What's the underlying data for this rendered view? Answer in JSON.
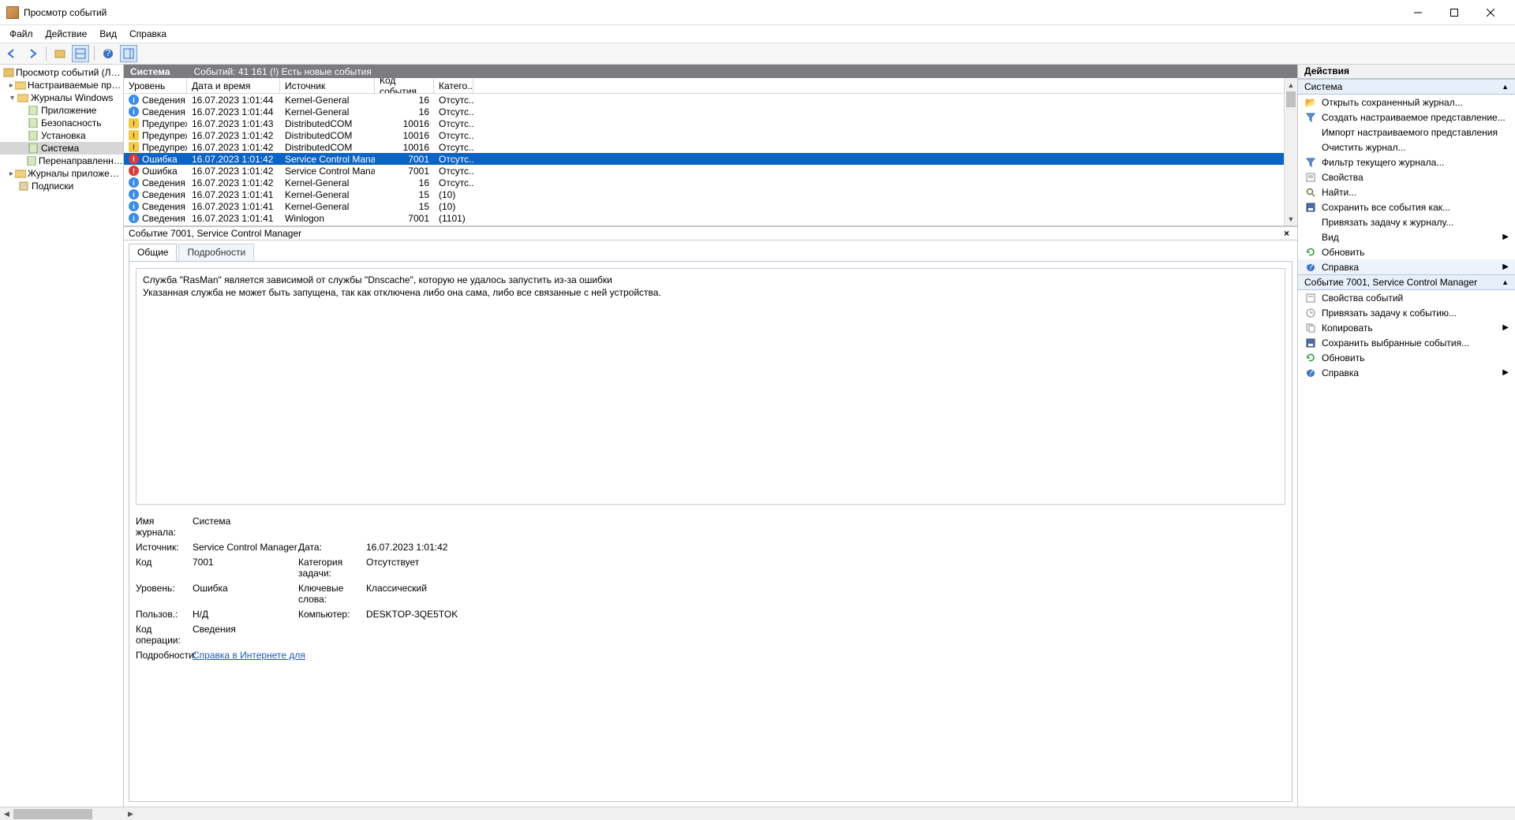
{
  "window": {
    "title": "Просмотр событий"
  },
  "menu": {
    "file": "Файл",
    "action": "Действие",
    "view": "Вид",
    "help": "Справка"
  },
  "tree": {
    "root": "Просмотр событий (Локальн",
    "custom_views": "Настраиваемые представл",
    "windows_logs": "Журналы Windows",
    "app": "Приложение",
    "security": "Безопасность",
    "setup": "Установка",
    "system": "Система",
    "forwarded": "Перенаправленные соб",
    "apps_services": "Журналы приложений и сл",
    "subscriptions": "Подписки"
  },
  "center_header": {
    "name": "Система",
    "info": "Событий: 41 161 (!) Есть новые события"
  },
  "columns": {
    "level": "Уровень",
    "datetime": "Дата и время",
    "source": "Источник",
    "event_id": "Код события",
    "category": "Катего..."
  },
  "levels": {
    "info": "Сведения",
    "warn": "Предупреж...",
    "error": "Ошибка"
  },
  "rows": [
    {
      "lvl": "info",
      "dt": "16.07.2023 1:01:44",
      "src": "Kernel-General",
      "id": "16",
      "cat": "Отсутс..."
    },
    {
      "lvl": "info",
      "dt": "16.07.2023 1:01:44",
      "src": "Kernel-General",
      "id": "16",
      "cat": "Отсутс..."
    },
    {
      "lvl": "warn",
      "dt": "16.07.2023 1:01:43",
      "src": "DistributedCOM",
      "id": "10016",
      "cat": "Отсутс..."
    },
    {
      "lvl": "warn",
      "dt": "16.07.2023 1:01:42",
      "src": "DistributedCOM",
      "id": "10016",
      "cat": "Отсутс..."
    },
    {
      "lvl": "warn",
      "dt": "16.07.2023 1:01:42",
      "src": "DistributedCOM",
      "id": "10016",
      "cat": "Отсутс..."
    },
    {
      "lvl": "error",
      "dt": "16.07.2023 1:01:42",
      "src": "Service Control Manager",
      "id": "7001",
      "cat": "Отсутс...",
      "selected": true
    },
    {
      "lvl": "error",
      "dt": "16.07.2023 1:01:42",
      "src": "Service Control Manager",
      "id": "7001",
      "cat": "Отсутс..."
    },
    {
      "lvl": "info",
      "dt": "16.07.2023 1:01:42",
      "src": "Kernel-General",
      "id": "16",
      "cat": "Отсутс..."
    },
    {
      "lvl": "info",
      "dt": "16.07.2023 1:01:41",
      "src": "Kernel-General",
      "id": "15",
      "cat": "(10)"
    },
    {
      "lvl": "info",
      "dt": "16.07.2023 1:01:41",
      "src": "Kernel-General",
      "id": "15",
      "cat": "(10)"
    },
    {
      "lvl": "info",
      "dt": "16.07.2023 1:01:41",
      "src": "Winlogon",
      "id": "7001",
      "cat": "(1101)"
    }
  ],
  "detail": {
    "caption": "Событие 7001, Service Control Manager",
    "tab_general": "Общие",
    "tab_details": "Подробности",
    "message_l1": "Служба \"RasMan\" является зависимой от службы \"Dnscache\", которую не удалось запустить из-за ошибки",
    "message_l2": "Указанная служба не может быть запущена, так как отключена либо она сама, либо все связанные с ней устройства.",
    "labels": {
      "log_name": "Имя журнала:",
      "source": "Источник:",
      "code": "Код",
      "level": "Уровень:",
      "user": "Пользов.:",
      "opcode": "Код операции:",
      "more_info": "Подробности:",
      "date": "Дата:",
      "task_category": "Категория задачи:",
      "keywords": "Ключевые слова:",
      "computer": "Компьютер:"
    },
    "values": {
      "log_name": "Система",
      "source": "Service Control Manager",
      "code": "7001",
      "level": "Ошибка",
      "user": "Н/Д",
      "opcode": "Сведения",
      "more_info": "Справка в Интернете для ",
      "date": "16.07.2023 1:01:42",
      "task_category": "Отсутствует",
      "keywords": "Классический",
      "computer": "DESKTOP-3QE5TOK"
    }
  },
  "actions": {
    "pane_title": "Действия",
    "group1": "Система",
    "group2": "Событие 7001, Service Control Manager",
    "items1": {
      "open_saved": "Открыть сохраненный журнал...",
      "create_view": "Создать настраиваемое представление...",
      "import_view": "Импорт настраиваемого представления",
      "clear_log": "Очистить журнал...",
      "filter": "Фильтр текущего журнала...",
      "properties": "Свойства",
      "find": "Найти...",
      "save_all": "Сохранить все события как...",
      "attach_to_log": "Привязать задачу к журналу...",
      "view": "Вид",
      "refresh": "Обновить",
      "help": "Справка"
    },
    "items2": {
      "event_props": "Свойства событий",
      "attach_to_event": "Привязать задачу к событию...",
      "copy": "Копировать",
      "save_selected": "Сохранить выбранные события...",
      "refresh": "Обновить",
      "help": "Справка"
    }
  }
}
